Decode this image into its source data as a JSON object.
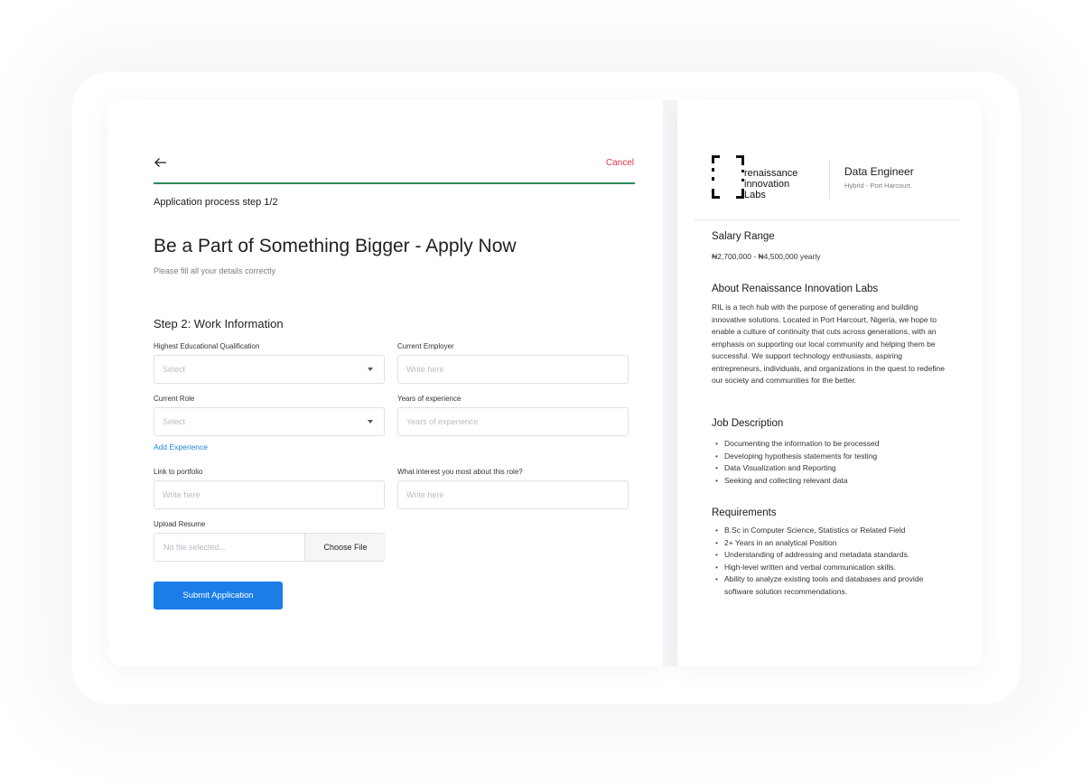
{
  "form": {
    "cancel_label": "Cancel",
    "step_label": "Application process step 1/2",
    "title": "Be a Part of Something Bigger - Apply Now",
    "subtitle": "Please fill all your details correctly",
    "section_title": "Step 2: Work Information",
    "fields": {
      "qualification": {
        "label": "Highest Educational Qualification",
        "placeholder": "Select"
      },
      "employer": {
        "label": "Current Employer",
        "placeholder": "Write here"
      },
      "role": {
        "label": "Current Role",
        "placeholder": "Select"
      },
      "experience": {
        "label": "Years of experience",
        "placeholder": "Years of experience"
      },
      "portfolio": {
        "label": "Link to portfolio",
        "placeholder": "Write here"
      },
      "interest": {
        "label": "What interest you most about this role?",
        "placeholder": "Write here"
      },
      "resume": {
        "label": "Upload Resume",
        "placeholder": "No file selected...",
        "button": "Choose File"
      }
    },
    "add_experience_label": "Add Experience",
    "submit_label": "Submit Application"
  },
  "job": {
    "logo_lines": [
      "renaissance",
      "innovation",
      "Labs"
    ],
    "title": "Data Engineer",
    "location": "Hybrid - Port Harcourt.",
    "salary_heading": "Salary Range",
    "salary": "₦2,700,000 - ₦4,500,000 yearly",
    "about_heading": "About Renaissance Innovation Labs",
    "about_text": "RIL is a tech hub with the purpose of generating and building innovative solutions. Located in Port Harcourt, Nigeria, we hope to enable a culture of continuity that cuts across generations, with an emphasis on supporting our local community and helping them be successful. We support technology enthusiasts, aspiring entrepreneurs, individuals, and organizations in the quest to redefine our society and communities for the better.",
    "description_heading": "Job Description",
    "description_items": [
      "Documenting the information to be processed",
      "Developing hypothesis statements for testing",
      "Data Visualization and Reporting",
      "Seeking and collecting relevant data"
    ],
    "requirements_heading": "Requirements",
    "requirements_items": [
      "B.Sc in Computer Science, Statistics or Related Field",
      "2+ Years in an analytical Position",
      "Understanding of addressing and metadata standards.",
      "High-level written and verbal communication skills.",
      "Ability to analyze existing tools and databases and provide software solution recommendations."
    ]
  },
  "colors": {
    "accent_blue": "#1b7ee8",
    "cancel_red": "#e0354a",
    "progress_green": "#2a8a5a"
  },
  "icons": {
    "back": "arrow-left-icon",
    "dropdown": "caret-down-icon",
    "logo": "bracket-logo"
  }
}
